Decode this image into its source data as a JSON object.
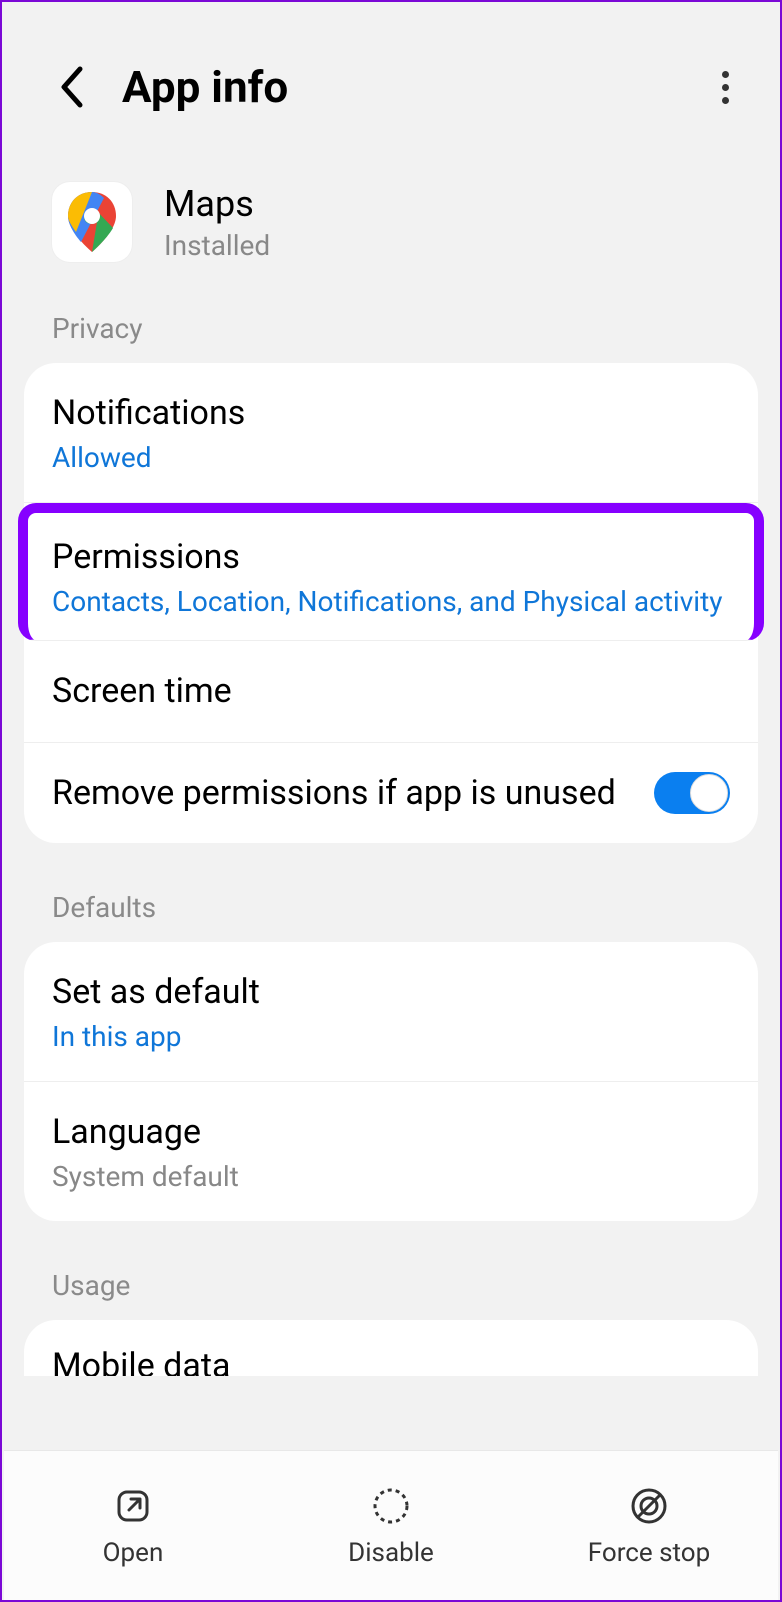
{
  "header": {
    "title": "App info"
  },
  "app": {
    "name": "Maps",
    "status": "Installed"
  },
  "sections": {
    "privacy": {
      "label": "Privacy",
      "notifications": {
        "title": "Notifications",
        "status": "Allowed"
      },
      "permissions": {
        "title": "Permissions",
        "summary": "Contacts, Location, Notifications, and Physical activity"
      },
      "screen_time": {
        "title": "Screen time"
      },
      "remove_perms": {
        "title": "Remove permissions if app is unused",
        "enabled": true
      }
    },
    "defaults": {
      "label": "Defaults",
      "set_default": {
        "title": "Set as default",
        "summary": "In this app"
      },
      "language": {
        "title": "Language",
        "summary": "System default"
      }
    },
    "usage": {
      "label": "Usage",
      "mobile_data": {
        "title": "Mobile data"
      }
    }
  },
  "bottom": {
    "open": "Open",
    "disable": "Disable",
    "force_stop": "Force stop"
  }
}
